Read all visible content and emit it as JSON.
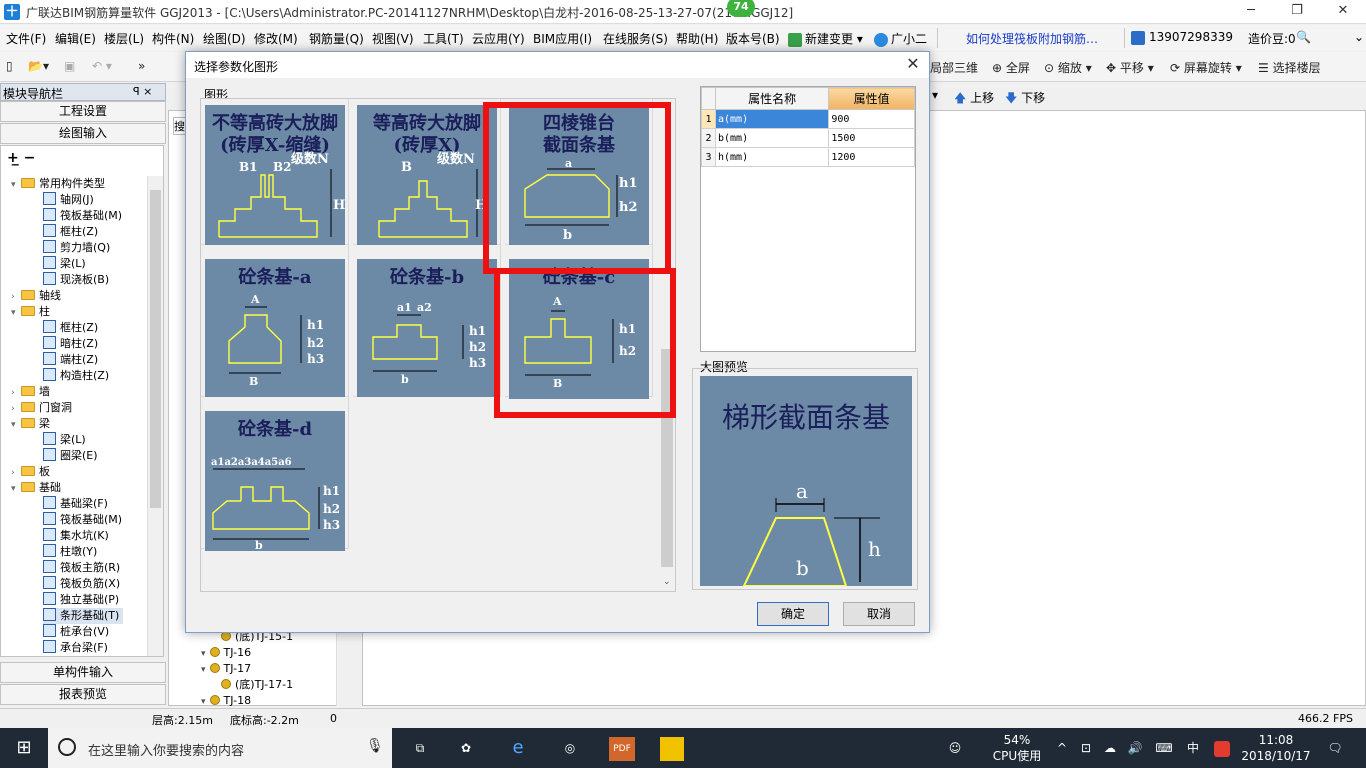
{
  "window": {
    "title": "广联达BIM钢筋算量软件 GGJ2013 - [C:\\Users\\Administrator.PC-20141127NRHM\\Desktop\\白龙村-2016-08-25-13-27-07(210...GGJ12]",
    "notification_badge": "74",
    "app_icon_text": "十"
  },
  "menu": {
    "items": [
      "文件(F)",
      "编辑(E)",
      "楼层(L)",
      "构件(N)",
      "绘图(D)",
      "修改(M)",
      "钢筋量(Q)",
      "视图(V)",
      "工具(T)",
      "云应用(Y)",
      "BIM应用(I)",
      "在线服务(S)",
      "帮助(H)",
      "版本号(B)"
    ],
    "new_change": "新建变更",
    "assistant": "广小二",
    "help_link": "如何处理筏板附加钢筋…",
    "phone": "13907298339",
    "credits": "造价豆:0"
  },
  "toolbar": {
    "items": [
      "局部三维",
      "全屏",
      "缩放",
      "平移",
      "屏幕旋转",
      "选择楼层"
    ],
    "move_up": "上移",
    "move_down": "下移"
  },
  "nav": {
    "header": "模块导航栏",
    "pin": "ꟼ ×",
    "engineering_settings": "工程设置",
    "drawing_input": "绘图输入",
    "single_input": "单构件输入",
    "report_preview": "报表预览",
    "tree": [
      {
        "t": "常用构件类型",
        "lvl": 0,
        "kind": "folder",
        "exp": "⌄"
      },
      {
        "t": "轴网(J)",
        "lvl": 1,
        "kind": "item"
      },
      {
        "t": "筏板基础(M)",
        "lvl": 1,
        "kind": "item"
      },
      {
        "t": "框柱(Z)",
        "lvl": 1,
        "kind": "item"
      },
      {
        "t": "剪力墙(Q)",
        "lvl": 1,
        "kind": "item"
      },
      {
        "t": "梁(L)",
        "lvl": 1,
        "kind": "item"
      },
      {
        "t": "现浇板(B)",
        "lvl": 1,
        "kind": "item"
      },
      {
        "t": "轴线",
        "lvl": 0,
        "kind": "folder",
        "exp": "›"
      },
      {
        "t": "柱",
        "lvl": 0,
        "kind": "folder",
        "exp": "⌄"
      },
      {
        "t": "框柱(Z)",
        "lvl": 1,
        "kind": "item"
      },
      {
        "t": "暗柱(Z)",
        "lvl": 1,
        "kind": "item"
      },
      {
        "t": "端柱(Z)",
        "lvl": 1,
        "kind": "item"
      },
      {
        "t": "构造柱(Z)",
        "lvl": 1,
        "kind": "item"
      },
      {
        "t": "墙",
        "lvl": 0,
        "kind": "folder",
        "exp": "›"
      },
      {
        "t": "门窗洞",
        "lvl": 0,
        "kind": "folder",
        "exp": "›"
      },
      {
        "t": "梁",
        "lvl": 0,
        "kind": "folder",
        "exp": "⌄"
      },
      {
        "t": "梁(L)",
        "lvl": 1,
        "kind": "item"
      },
      {
        "t": "圈梁(E)",
        "lvl": 1,
        "kind": "item"
      },
      {
        "t": "板",
        "lvl": 0,
        "kind": "folder",
        "exp": "›"
      },
      {
        "t": "基础",
        "lvl": 0,
        "kind": "folder",
        "exp": "⌄"
      },
      {
        "t": "基础梁(F)",
        "lvl": 1,
        "kind": "item"
      },
      {
        "t": "筏板基础(M)",
        "lvl": 1,
        "kind": "item"
      },
      {
        "t": "集水坑(K)",
        "lvl": 1,
        "kind": "item"
      },
      {
        "t": "柱墩(Y)",
        "lvl": 1,
        "kind": "item"
      },
      {
        "t": "筏板主筋(R)",
        "lvl": 1,
        "kind": "item"
      },
      {
        "t": "筏板负筋(X)",
        "lvl": 1,
        "kind": "item"
      },
      {
        "t": "独立基础(P)",
        "lvl": 1,
        "kind": "item"
      },
      {
        "t": "条形基础(T)",
        "lvl": 1,
        "kind": "item",
        "selected": true
      },
      {
        "t": "桩承台(V)",
        "lvl": 1,
        "kind": "item"
      },
      {
        "t": "承台梁(F)",
        "lvl": 1,
        "kind": "item"
      }
    ]
  },
  "midlist": {
    "search_placeholder": "搜",
    "items": [
      {
        "t": "(底)TJ-15-1",
        "lvl": 2
      },
      {
        "t": "TJ-16",
        "lvl": 1
      },
      {
        "t": "TJ-17",
        "lvl": 1
      },
      {
        "t": "(底)TJ-17-1",
        "lvl": 2
      },
      {
        "t": "TJ-18",
        "lvl": 1
      }
    ]
  },
  "dialog": {
    "title": "选择参数化图形",
    "group_label": "图形",
    "shapes": [
      {
        "title": "不等高砖大放脚(砖厚X-缩缝)",
        "lines": [
          "不等高砖大放脚",
          "(砖厚X-缩缝)"
        ],
        "labels": [
          "B1",
          "B2",
          "级数N",
          "H"
        ]
      },
      {
        "title": "等高砖大放脚(砖厚X)",
        "lines": [
          "等高砖大放脚",
          "(砖厚X)"
        ],
        "labels": [
          "B",
          "级数N",
          "H"
        ]
      },
      {
        "title": "四棱锥台截面条基",
        "lines": [
          "四棱锥台",
          "截面条基"
        ],
        "labels": [
          "a",
          "h1",
          "h2",
          "b"
        ]
      },
      {
        "title": "砼条基-a",
        "lines": [
          "砼条基-a"
        ],
        "labels": [
          "A",
          "h1",
          "h2",
          "h3",
          "B"
        ]
      },
      {
        "title": "砼条基-b",
        "lines": [
          "砼条基-b"
        ],
        "labels": [
          "a1",
          "a2",
          "h1",
          "h2",
          "h3",
          "b"
        ]
      },
      {
        "title": "砼条基-c",
        "lines": [
          "砼条基-c"
        ],
        "labels": [
          "A",
          "h1",
          "h2",
          "B"
        ]
      },
      {
        "title": "砼条基-d",
        "lines": [
          "砼条基-d"
        ],
        "labels": [
          "a1a2a3a4a5a6",
          "h1",
          "h2",
          "h3",
          "b"
        ]
      }
    ],
    "props": {
      "col_name": "属性名称",
      "col_value": "属性值",
      "rows": [
        {
          "idx": "1",
          "name": "a(mm)",
          "value": "900"
        },
        {
          "idx": "2",
          "name": "b(mm)",
          "value": "1500"
        },
        {
          "idx": "3",
          "name": "h(mm)",
          "value": "1200"
        }
      ]
    },
    "preview_label": "大图预览",
    "preview": {
      "title": "梯形截面条基",
      "labels": [
        "a",
        "h",
        "b"
      ]
    },
    "ok": "确定",
    "cancel": "取消"
  },
  "status": {
    "floor_height": "层高:2.15m",
    "bottom_elev": "底标高:-2.2m",
    "value": "0",
    "fps": "466.2 FPS"
  },
  "taskbar": {
    "search_placeholder": "在这里输入你要搜索的内容",
    "cpu_pct": "54%",
    "cpu_label": "CPU使用",
    "time": "11:08",
    "date": "2018/10/17",
    "ime": "中"
  },
  "colors": {
    "thumb_bg": "#6c8aa6",
    "thumb_title": "#1a1f5a",
    "highlight": "#ee1111",
    "shape_line": "#ffff40"
  }
}
